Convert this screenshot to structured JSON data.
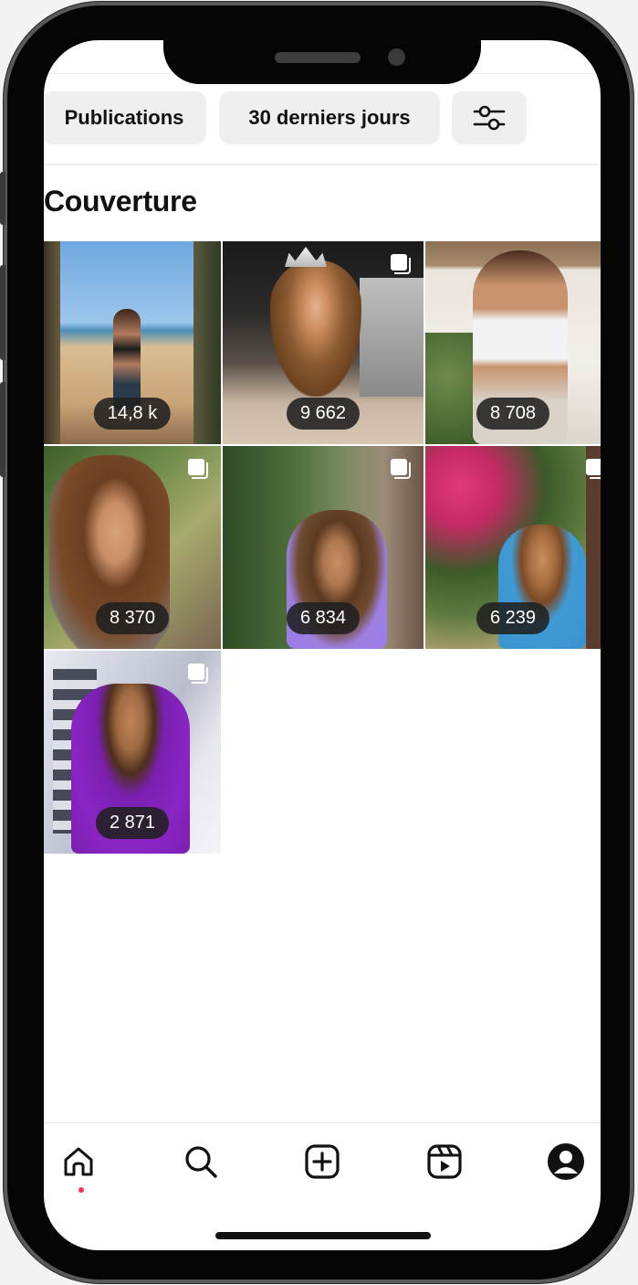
{
  "filters": {
    "content_type": "Publications",
    "period": "30 derniers jours",
    "settings_icon": "sliders-icon"
  },
  "section": {
    "title": "Couverture"
  },
  "posts": [
    {
      "metric": "14,8 k",
      "multi": false
    },
    {
      "metric": "9 662",
      "multi": true
    },
    {
      "metric": "8 708",
      "multi": false
    },
    {
      "metric": "8 370",
      "multi": true
    },
    {
      "metric": "6 834",
      "multi": true
    },
    {
      "metric": "6 239",
      "multi": true
    },
    {
      "metric": "2 871",
      "multi": true
    }
  ],
  "tabbar": {
    "items": [
      "home-icon",
      "search-icon",
      "create-icon",
      "reels-icon",
      "profile-icon"
    ],
    "active": "home-icon"
  },
  "colors": {
    "notification_dot": "#ff2d55",
    "chip_bg": "#efefef",
    "badge_bg": "#202020"
  }
}
